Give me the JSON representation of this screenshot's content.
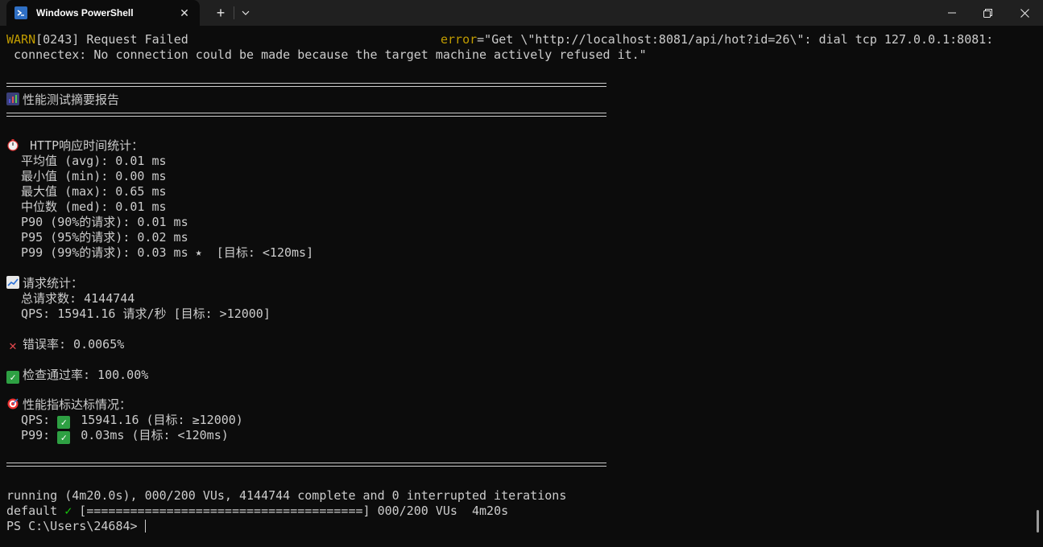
{
  "window": {
    "tab_title": "Windows PowerShell",
    "tab_icon": "powershell-icon",
    "new_tab_symbol": "+",
    "close_symbol": "✕"
  },
  "terminal": {
    "warn_prefix": "WARN",
    "warn_rest": "[0243] Request Failed",
    "warn_error_key": "error",
    "warn_error_value": "=\"Get \\\"http://localhost:8081/api/hot?id=26\\\": dial tcp 127.0.0.1:8081:",
    "warn_line2": " connectex: No connection could be made because the target machine actively refused it.\"",
    "report_title": "性能测试摘要报告",
    "http_header": " HTTP响应时间统计：",
    "http_stats": [
      "  平均值 (avg): 0.01 ms",
      "  最小值 (min): 0.00 ms",
      "  最大值 (max): 0.65 ms",
      "  中位数 (med): 0.01 ms",
      "  P90 (90%的请求): 0.01 ms",
      "  P95 (95%的请求): 0.02 ms",
      "  P99 (99%的请求): 0.03 ms ⭑  [目标: <120ms]"
    ],
    "req_header": "请求统计：",
    "req_stats": [
      "  总请求数: 4144744",
      "  QPS: 15941.16 请求/秒 [目标: >12000]"
    ],
    "error_rate": "错误率: 0.0065%",
    "check_rate": "检查通过率: 100.00%",
    "perf_header": "性能指标达标情况：",
    "perf_qps_label": "  QPS: ",
    "perf_qps_value": " 15941.16 (目标: ≥12000)",
    "perf_p99_label": "  P99: ",
    "perf_p99_value": " 0.03ms (目标: <120ms)",
    "running_line": "running (4m20.0s), 000/200 VUs, 4144744 complete and 0 interrupted iterations",
    "default_prefix": "default ",
    "default_check": "✓",
    "default_rest": " [======================================] 000/200 VUs  4m20s",
    "prompt": "PS C:\\Users\\24684> "
  },
  "colors": {
    "background": "#0c0c0c",
    "foreground": "#cccccc",
    "warn": "#c19c00",
    "titlebar": "#202020",
    "check_green": "#2ea043"
  }
}
